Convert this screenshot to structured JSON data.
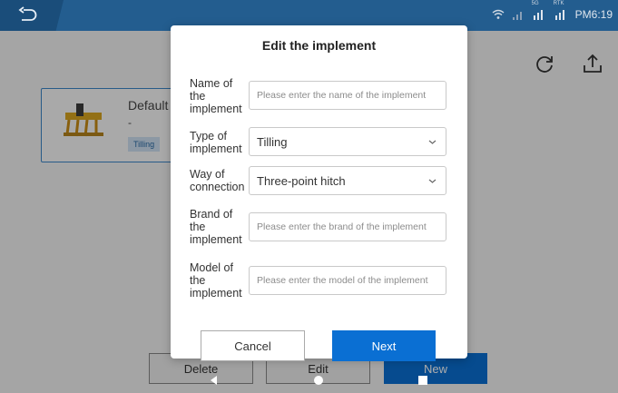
{
  "status_bar": {
    "time": "PM6:19",
    "signal_a_label": "5G",
    "signal_b_label": "RTK"
  },
  "background": {
    "card": {
      "title": "Default",
      "subtitle": "-",
      "badge": "Tilling"
    },
    "buttons": {
      "delete": "Delete",
      "edit": "Edit",
      "new": "New"
    }
  },
  "modal": {
    "title": "Edit the implement",
    "fields": [
      {
        "label": "Name of the implement",
        "placeholder": "Please enter the name of the implement",
        "value": ""
      },
      {
        "label": "Type of implement",
        "value": "Tilling"
      },
      {
        "label": "Way of connection",
        "value": "Three-point hitch"
      },
      {
        "label": "Brand of the implement",
        "placeholder": "Please enter the brand of the implement",
        "value": ""
      },
      {
        "label": "Model of the implement",
        "placeholder": "Please enter the model of the implement",
        "value": ""
      }
    ],
    "cancel_label": "Cancel",
    "next_label": "Next"
  },
  "colors": {
    "primary": "#0a6fd3",
    "topbar": "#235d8f",
    "card_border": "#3c87c9"
  },
  "icons": [
    "back-icon",
    "wifi-icon",
    "signal-icon",
    "refresh-icon",
    "upload-icon",
    "chevron-down-icon",
    "nav-back-icon",
    "nav-home-icon",
    "nav-recent-icon"
  ]
}
